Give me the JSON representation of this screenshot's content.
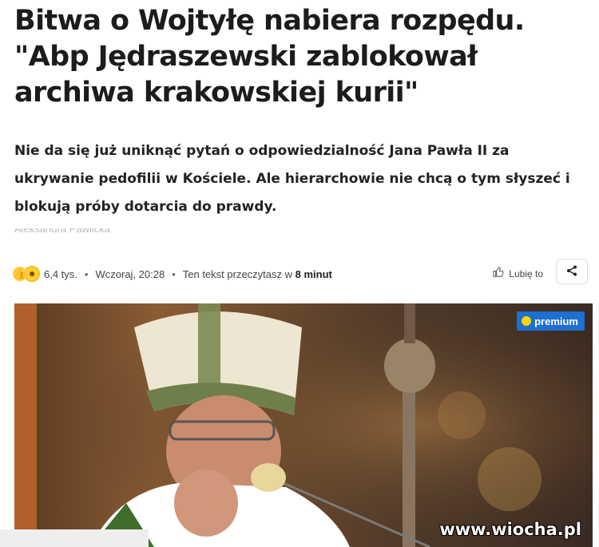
{
  "article": {
    "headline": "Bitwa o Wojtyłę nabiera rozpędu. \"Abp Jędraszewski zablokował archiwa krakowskiej kurii\"",
    "lead": "Nie da się już uniknąć pytań o odpowiedzialność Jana Pawła II za ukrywanie pedofilii w Kościele. Ale hierarchowie nie chcą o tym słyszeć i blokują próby dotarcia do prawdy.",
    "author": "Aleksandra Pawlicka"
  },
  "meta": {
    "reactions_count": "6,4 tys.",
    "separator": "•",
    "date": "Wczoraj, 20:28",
    "read_prefix": "Ten tekst przeczytasz w",
    "read_time": "8 minut",
    "like_label": "Lubię to"
  },
  "photo": {
    "badge": "premium",
    "watermark": "www.wiocha.pl"
  },
  "colors": {
    "premium_badge": "#1f6fd1",
    "premium_dot": "#ffd400"
  }
}
